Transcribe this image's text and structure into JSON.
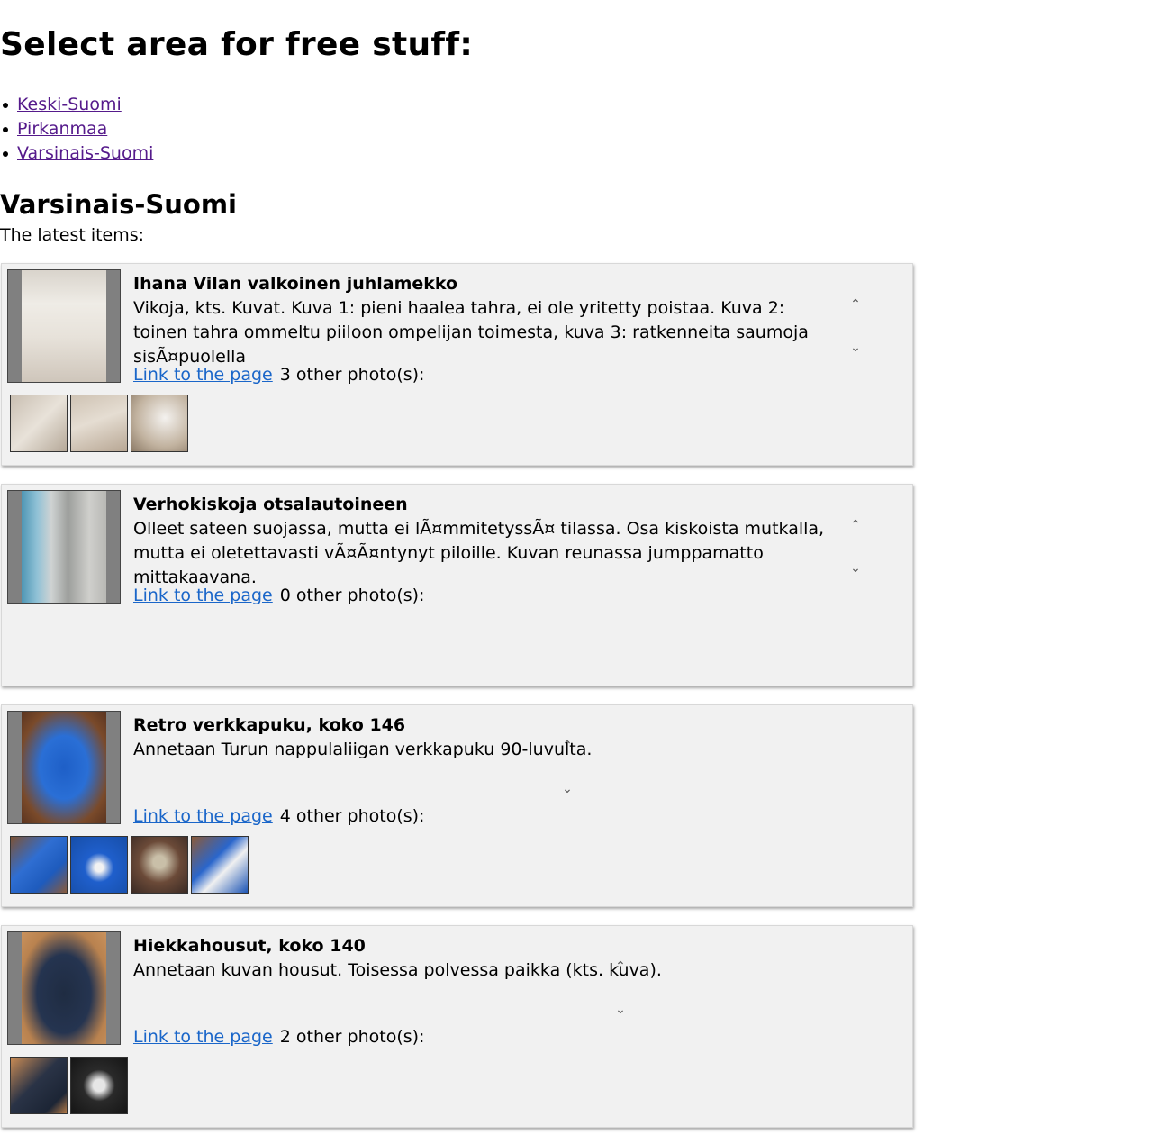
{
  "page_title": "Select area for free stuff:",
  "areas": [
    "Keski-Suomi",
    "Pirkanmaa",
    "Varsinais-Suomi"
  ],
  "current_area": "Varsinais-Suomi",
  "latest_label": "The latest items:",
  "link_label": "Link to the page",
  "items": [
    {
      "title": "Ihana Vilan valkoinen juhlamekko",
      "description": "Vikoja, kts. Kuvat. Kuva 1: pieni haalea tahra, ei ole yritetty poistaa. Kuva 2: toinen tahra ommeltu piiloon ompelijan toimesta, kuva 3: ratkenneita saumoja sisÃ¤puolella",
      "photos_text": "3 other photo(s):"
    },
    {
      "title": "Verhokiskoja otsalautoineen",
      "description": "Olleet sateen suojassa, mutta ei lÃ¤mmitetyssÃ¤ tilassa. Osa kiskoista mutkalla, mutta ei oletettavasti vÃ¤Ã¤ntynyt piloille. Kuvan reunassa jumppamatto mittakaavana.",
      "photos_text": "0 other photo(s):"
    },
    {
      "title": "Retro verkkapuku, koko 146",
      "description": "Annetaan Turun nappulaliigan verkkapuku 90-luvulta.",
      "photos_text": "4 other photo(s):"
    },
    {
      "title": "Hiekkahousut, koko 140",
      "description": "Annetaan kuvan housut. Toisessa polvessa paikka (kts. kuva).",
      "photos_text": "2 other photo(s):"
    }
  ],
  "icons": {
    "scroll_up": "chevron-up-icon",
    "scroll_down": "chevron-down-icon"
  },
  "colors": {
    "visited_link": "#551a8b",
    "link": "#1a66c9",
    "card_bg": "#f1f1f1"
  }
}
